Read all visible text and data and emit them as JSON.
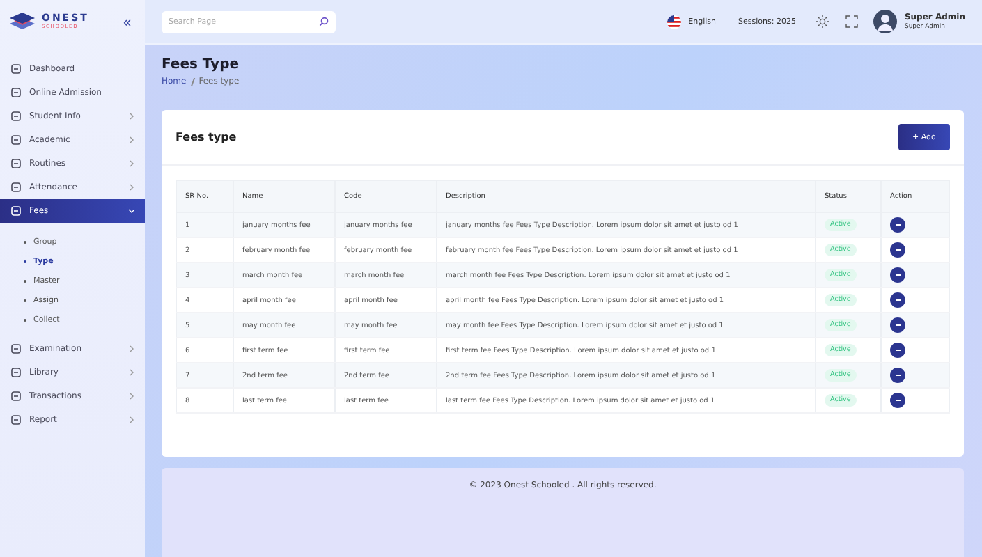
{
  "logo": {
    "name": "ONEST",
    "tagline": "SCHOOLED"
  },
  "collapse": "«",
  "search": {
    "placeholder": "Search Page"
  },
  "header": {
    "language": "English",
    "session": "Sessions: 2025",
    "user_name": "Super Admin",
    "user_role": "Super Admin"
  },
  "sidebar": {
    "items": [
      {
        "label": "Dashboard",
        "selected": false
      },
      {
        "label": "Online Admission",
        "selected": false
      },
      {
        "label": "Student Info",
        "expanded": false,
        "selected": false
      },
      {
        "label": "Academic",
        "expanded": false,
        "selected": false
      },
      {
        "label": "Routines",
        "expanded": false,
        "selected": false
      },
      {
        "label": "Attendance",
        "expanded": false,
        "selected": false
      },
      {
        "label": "Fees",
        "expanded": true,
        "selected": true,
        "children": [
          {
            "label": "Group",
            "selected": false
          },
          {
            "label": "Type",
            "selected": true
          },
          {
            "label": "Master",
            "selected": false
          },
          {
            "label": "Assign",
            "selected": false
          },
          {
            "label": "Collect",
            "selected": false
          }
        ]
      },
      {
        "label": "Examination",
        "expanded": false,
        "selected": false
      },
      {
        "label": "Library",
        "expanded": false,
        "selected": false
      },
      {
        "label": "Transactions",
        "expanded": false,
        "selected": false
      },
      {
        "label": "Report",
        "expanded": false,
        "selected": false
      }
    ]
  },
  "page": {
    "title": "Fees Type",
    "breadcrumb": [
      "Home",
      "Fees type"
    ]
  },
  "card": {
    "title": "Fees type",
    "add_button": "+ Add"
  },
  "table": {
    "columns": [
      "SR No.",
      "Name",
      "Code",
      "Description",
      "Status",
      "Action"
    ],
    "rows": [
      {
        "sr": "1",
        "name": "january months fee",
        "code": "january months fee",
        "description": "january months fee Fees Type Description. Lorem ipsum dolor sit amet et justo od 1",
        "status": "Active"
      },
      {
        "sr": "2",
        "name": "february month fee",
        "code": "february month fee",
        "description": "february month fee Fees Type Description. Lorem ipsum dolor sit amet et justo od 1",
        "status": "Active"
      },
      {
        "sr": "3",
        "name": "march month fee",
        "code": "march month fee",
        "description": "march month fee Fees Type Description. Lorem ipsum dolor sit amet et justo od 1",
        "status": "Active"
      },
      {
        "sr": "4",
        "name": "april month fee",
        "code": "april month fee",
        "description": "april month fee Fees Type Description. Lorem ipsum dolor sit amet et justo od 1",
        "status": "Active"
      },
      {
        "sr": "5",
        "name": "may month fee",
        "code": "may month fee",
        "description": "may month fee Fees Type Description. Lorem ipsum dolor sit amet et justo od 1",
        "status": "Active"
      },
      {
        "sr": "6",
        "name": "first term fee",
        "code": "first term fee",
        "description": "first term fee Fees Type Description. Lorem ipsum dolor sit amet et justo od 1",
        "status": "Active"
      },
      {
        "sr": "7",
        "name": "2nd term fee",
        "code": "2nd term fee",
        "description": "2nd term fee Fees Type Description. Lorem ipsum dolor sit amet et justo od 1",
        "status": "Active"
      },
      {
        "sr": "8",
        "name": "last term fee",
        "code": "last term fee",
        "description": "last term fee Fees Type Description. Lorem ipsum dolor sit amet et justo od 1",
        "status": "Active"
      }
    ]
  },
  "footer": "© 2023 Onest Schooled . All rights reserved."
}
